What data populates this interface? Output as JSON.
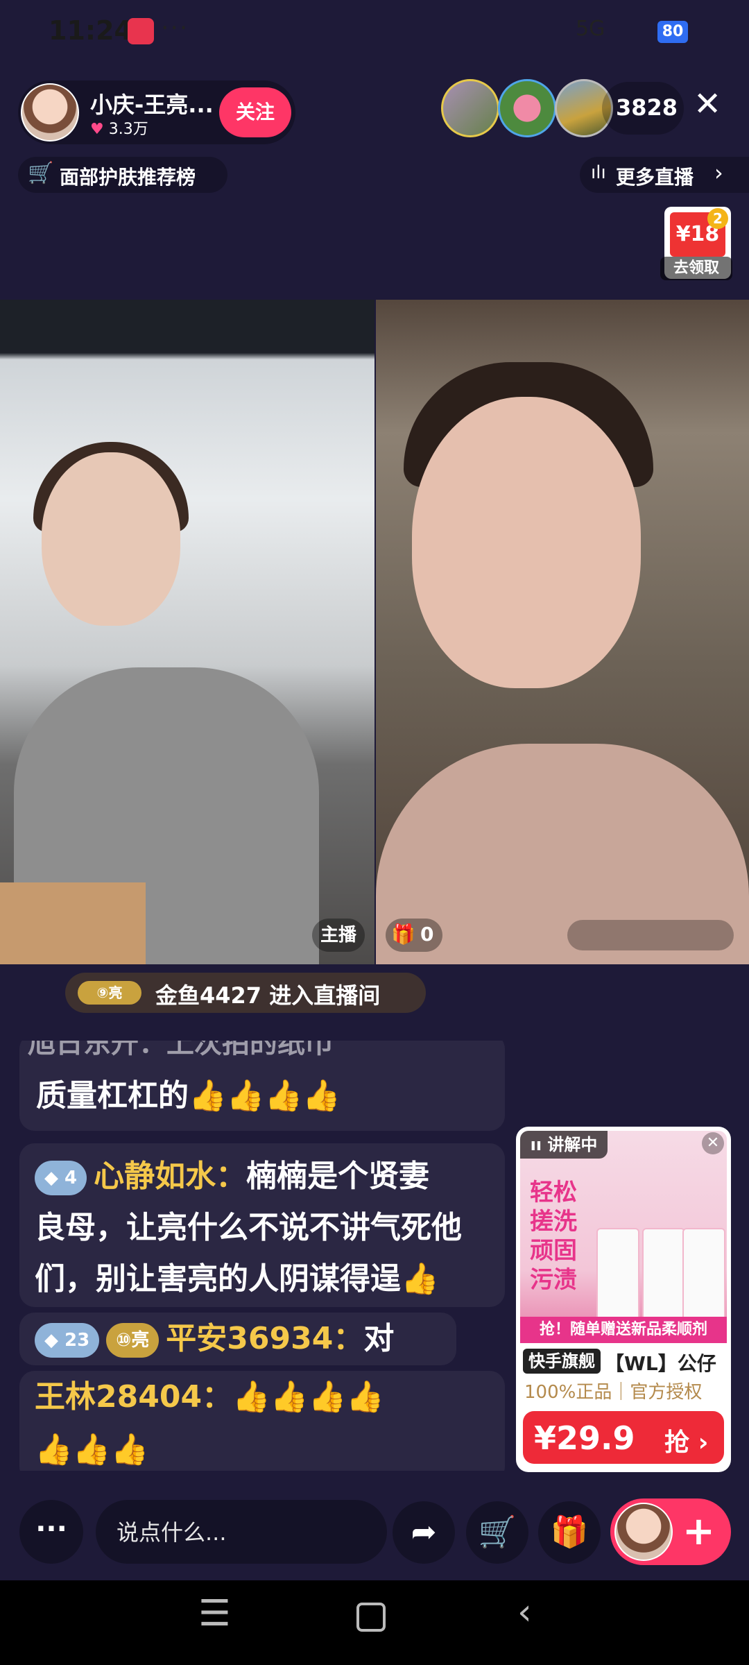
{
  "status_bar": {
    "time": "11:24",
    "dots": "···",
    "signal": "5G",
    "battery": "80"
  },
  "host": {
    "name": "小庆-王亮...",
    "likes": "3.3万",
    "follow_label": "关注"
  },
  "viewers": {
    "count": "3828"
  },
  "ranking": {
    "label": "面部护肤推荐榜"
  },
  "more_live": {
    "label": "更多直播"
  },
  "coupon": {
    "amount": "¥18",
    "badge": "2",
    "label": "去领取"
  },
  "video": {
    "host_tag": "主播",
    "gift_count": "0"
  },
  "enter_banner": {
    "badge": "⑨亮",
    "text": "金鱼4427 进入直播间"
  },
  "chat": [
    {
      "text": "旭日东升：上次拍的纸巾"
    },
    {
      "text": "质量杠杠的"
    },
    {
      "level": "4",
      "user": "心静如水：",
      "text": "楠楠是个贤妻"
    },
    {
      "text": "良母，让亮什么不说不讲气死他"
    },
    {
      "text": "们，别让害亮的人阴谋得逞"
    },
    {
      "level": "23",
      "fans": "⑩亮",
      "user": "平安36934：",
      "text": "对"
    },
    {
      "user": "王林28404：",
      "text": ""
    }
  ],
  "product": {
    "tag": "讲解中",
    "slogan": "轻松搓洗顽固污渍",
    "promo": "抢！随单赠送新品柔顺剂",
    "shop": "快手旗舰",
    "title": "【WL】公仔",
    "auth": "100%正品｜官方授权",
    "price": "¥29.9",
    "grab": "抢"
  },
  "bottom": {
    "more": "···",
    "placeholder": "说点什么..."
  },
  "colors": {
    "background": "#1e1a38",
    "accent": "#fe3666",
    "gold": "#f5c84a",
    "price_red": "#ee2a38"
  }
}
